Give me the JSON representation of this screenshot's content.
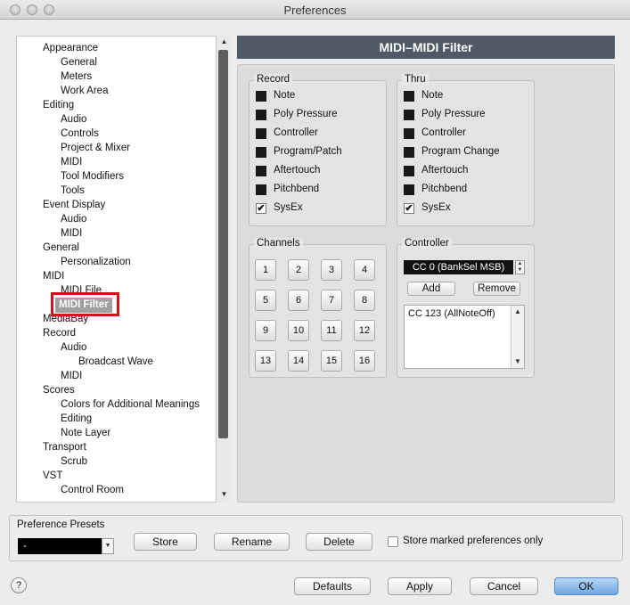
{
  "window": {
    "title": "Preferences"
  },
  "tree": [
    {
      "label": "Appearance",
      "level": 0
    },
    {
      "label": "General",
      "level": 1
    },
    {
      "label": "Meters",
      "level": 1
    },
    {
      "label": "Work Area",
      "level": 1
    },
    {
      "label": "Editing",
      "level": 0
    },
    {
      "label": "Audio",
      "level": 1
    },
    {
      "label": "Controls",
      "level": 1
    },
    {
      "label": "Project & Mixer",
      "level": 1
    },
    {
      "label": "MIDI",
      "level": 1
    },
    {
      "label": "Tool Modifiers",
      "level": 1
    },
    {
      "label": "Tools",
      "level": 1
    },
    {
      "label": "Event Display",
      "level": 0
    },
    {
      "label": "Audio",
      "level": 1
    },
    {
      "label": "MIDI",
      "level": 1
    },
    {
      "label": "General",
      "level": 0
    },
    {
      "label": "Personalization",
      "level": 1
    },
    {
      "label": "MIDI",
      "level": 0
    },
    {
      "label": "MIDI File",
      "level": 1
    },
    {
      "label": "MIDI Filter",
      "level": 1,
      "selected": true
    },
    {
      "label": "MediaBay",
      "level": 0
    },
    {
      "label": "Record",
      "level": 0
    },
    {
      "label": "Audio",
      "level": 1
    },
    {
      "label": "Broadcast Wave",
      "level": 2
    },
    {
      "label": "MIDI",
      "level": 1
    },
    {
      "label": "Scores",
      "level": 0
    },
    {
      "label": "Colors for Additional Meanings",
      "level": 1
    },
    {
      "label": "Editing",
      "level": 1
    },
    {
      "label": "Note Layer",
      "level": 1
    },
    {
      "label": "Transport",
      "level": 0
    },
    {
      "label": "Scrub",
      "level": 1
    },
    {
      "label": "VST",
      "level": 0
    },
    {
      "label": "Control Room",
      "level": 1
    }
  ],
  "panel": {
    "title": "MIDI–MIDI Filter"
  },
  "record": {
    "title": "Record",
    "items": [
      {
        "label": "Note",
        "checked": false
      },
      {
        "label": "Poly Pressure",
        "checked": false
      },
      {
        "label": "Controller",
        "checked": false
      },
      {
        "label": "Program/Patch",
        "checked": false
      },
      {
        "label": "Aftertouch",
        "checked": false
      },
      {
        "label": "Pitchbend",
        "checked": false
      },
      {
        "label": "SysEx",
        "checked": true
      }
    ]
  },
  "thru": {
    "title": "Thru",
    "items": [
      {
        "label": "Note",
        "checked": false
      },
      {
        "label": "Poly Pressure",
        "checked": false
      },
      {
        "label": "Controller",
        "checked": false
      },
      {
        "label": "Program Change",
        "checked": false
      },
      {
        "label": "Aftertouch",
        "checked": false
      },
      {
        "label": "Pitchbend",
        "checked": false
      },
      {
        "label": "SysEx",
        "checked": true
      }
    ]
  },
  "channels": {
    "title": "Channels",
    "buttons": [
      "1",
      "2",
      "3",
      "4",
      "5",
      "6",
      "7",
      "8",
      "9",
      "10",
      "11",
      "12",
      "13",
      "14",
      "15",
      "16"
    ]
  },
  "controller": {
    "title": "Controller",
    "selected": "CC 0  (BankSel MSB)",
    "add_label": "Add",
    "remove_label": "Remove",
    "list": [
      "CC 123  (AllNoteOff)"
    ]
  },
  "presets": {
    "label": "Preference Presets",
    "value": "-",
    "store_label": "Store",
    "rename_label": "Rename",
    "delete_label": "Delete",
    "store_marked_label": "Store marked preferences only"
  },
  "footer": {
    "help": "?",
    "defaults": "Defaults",
    "apply": "Apply",
    "cancel": "Cancel",
    "ok": "OK"
  },
  "icons": {
    "check": "✔",
    "arrow_up": "▲",
    "arrow_down": "▼"
  }
}
